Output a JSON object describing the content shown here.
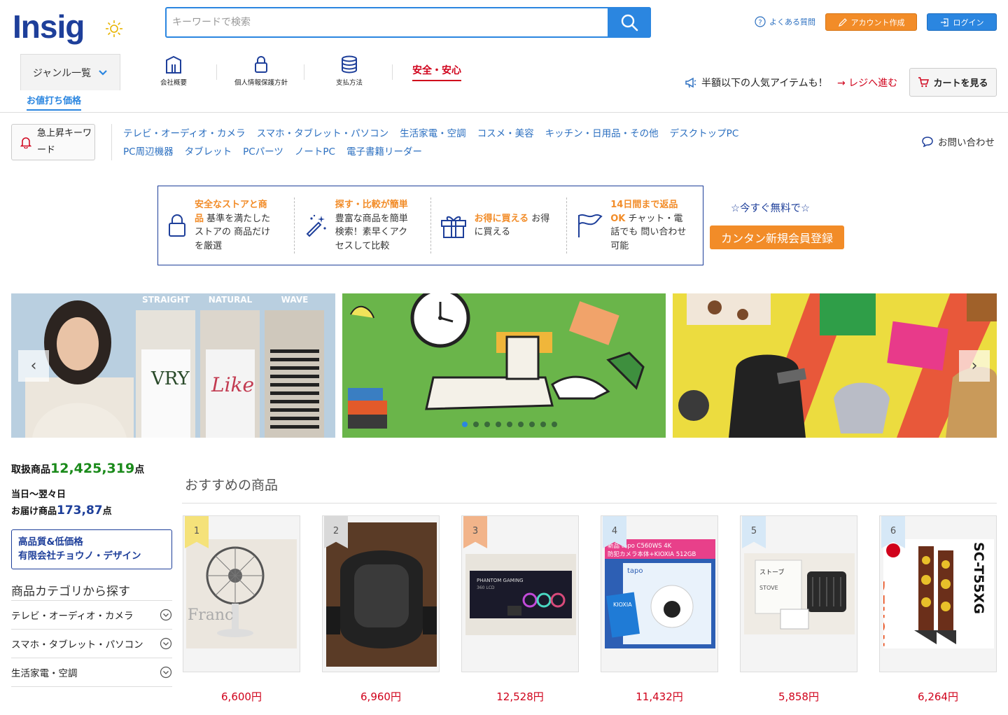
{
  "header": {
    "logo": "Insig",
    "search_placeholder": "キーワードで検索",
    "faq": "よくある質問",
    "create_account": "アカウント作成",
    "login": "ログイン"
  },
  "nav": {
    "genre": "ジャンル一覧",
    "items": [
      "会社概要",
      "個人情報保護方針",
      "支払方法"
    ],
    "safe": "安全・安心",
    "discount_tab": "お値打ち価格",
    "half_note": "半額以下の人気アイテムも！",
    "checkout": "→ レジへ進む",
    "cart": "カートを見る"
  },
  "keywords": {
    "button": "急上昇キーワード",
    "categories": [
      "テレビ・オーディオ・カメラ",
      "スマホ・タブレット・パソコン",
      "生活家電・空調",
      "コスメ・美容",
      "キッチン・日用品・その他",
      "デスクトップPC",
      "PC周辺機器",
      "タブレット",
      "PCパーツ",
      "ノートPC",
      "電子書籍リーダー"
    ],
    "contact": "お問い合わせ"
  },
  "features": [
    {
      "title": "安全なストアと商品",
      "text": "基準を満たしたストアの 商品だけを厳選"
    },
    {
      "title": "探す・比較が簡単",
      "text": "豊富な商品を簡単検索！素早くアクセスして比較"
    },
    {
      "title": "お得に買える",
      "text": "お得に買える"
    },
    {
      "title": "14日間まで返品OK",
      "text": "チャット・電話でも 問い合わせ可能"
    }
  ],
  "signup": {
    "free": "☆今すぐ無料で☆",
    "button": "カンタン新規会員登録"
  },
  "banners": {
    "labels": [
      "STRAIGHT",
      "NATURAL",
      "WAVE"
    ]
  },
  "stats": {
    "products_label": "取扱商品",
    "products_count": "12,425,319",
    "unit": "点",
    "delivery_line1": "当日〜翌々日",
    "delivery_label": "お届け商品",
    "delivery_count": "173,87",
    "shop_line1": "高品質&低価格",
    "shop_line2": "有限会社チョウノ・デザイン"
  },
  "sidebar": {
    "title": "商品カテゴリから探す",
    "items": [
      "テレビ・オーディオ・カメラ",
      "スマホ・タブレット・パソコン",
      "生活家電・空調"
    ]
  },
  "recommend": {
    "title": "おすすめの商品",
    "products": [
      {
        "rank": "1",
        "price": "6,600円",
        "rank_color": "#f5e27a"
      },
      {
        "rank": "2",
        "price": "6,960円",
        "rank_color": "#d9d9d9"
      },
      {
        "rank": "3",
        "price": "12,528円",
        "rank_color": "#f2b48a"
      },
      {
        "rank": "4",
        "price": "11,432円",
        "rank_color": "#d6e8f7"
      },
      {
        "rank": "5",
        "price": "5,858円",
        "rank_color": "#d6e8f7"
      },
      {
        "rank": "6",
        "price": "6,264円",
        "rank_color": "#d6e8f7"
      }
    ]
  },
  "colors": {
    "brand": "#1e3f9a",
    "accent": "#2b86e0",
    "orange": "#f28c28",
    "price": "#d0021b"
  }
}
